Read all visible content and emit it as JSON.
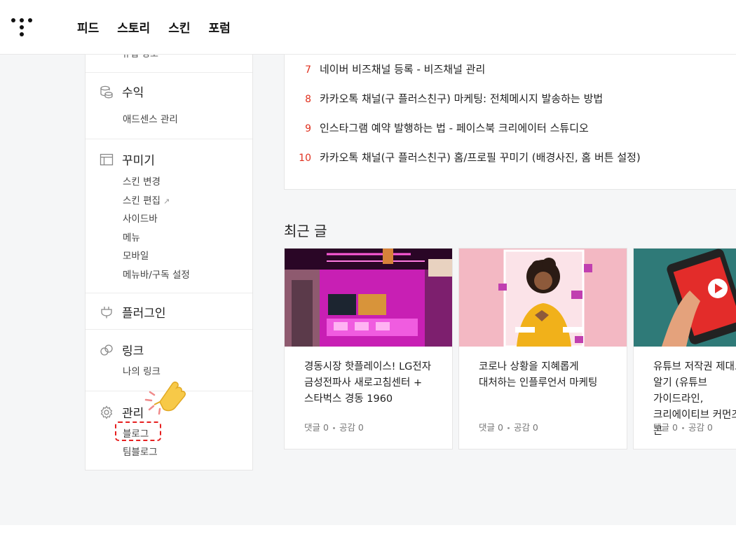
{
  "header": {
    "nav": [
      "피드",
      "스토리",
      "스킨",
      "포럼"
    ]
  },
  "sidebar": {
    "cut_top_label": "유입 경로",
    "sections": [
      {
        "title": "수익",
        "icon": "coins-icon",
        "items": [
          "애드센스 관리"
        ]
      },
      {
        "title": "꾸미기",
        "icon": "layout-icon",
        "items": [
          "스킨 변경",
          "스킨 편집",
          "사이드바",
          "메뉴",
          "모바일",
          "메뉴바/구독 설정"
        ]
      },
      {
        "title": "플러그인",
        "icon": "plug-icon",
        "items": []
      },
      {
        "title": "링크",
        "icon": "link-icon",
        "items": [
          "나의 링크"
        ]
      },
      {
        "title": "관리",
        "icon": "gear-icon",
        "items": [
          "블로그",
          "팀블로그"
        ]
      }
    ],
    "external_icon": "external-link-icon",
    "highlight_color": "#e62020",
    "pointer_color": "#f7c948"
  },
  "popular": {
    "rank_color": "#e0311f",
    "rows": [
      {
        "rank": "7",
        "title": "네이버 비즈채널 등록 - 비즈채널 관리"
      },
      {
        "rank": "8",
        "title": "카카오톡 채널(구 플러스친구) 마케팅: 전체메시지 발송하는 방법"
      },
      {
        "rank": "9",
        "title": "인스타그램 예약 발행하는 법 - 페이스북 크리에이터 스튜디오"
      },
      {
        "rank": "10",
        "title": "카카오톡 채널(구 플러스친구) 홈/프로필 꾸미기 (배경사진, 홈 버튼 설정)"
      }
    ]
  },
  "recent": {
    "heading": "최근 글",
    "posts": [
      {
        "title": "경동시장 핫플레이스! LG전자 금성전파사 새로고침센터 + 스타벅스 경동 1960",
        "comments": "댓글 0",
        "likes": "공감 0"
      },
      {
        "title": "코로나 상황을 지혜롭게 대처하는 인플루언서 마케팅",
        "comments": "댓글 0",
        "likes": "공감 0"
      },
      {
        "title": "유튜브 저작권 제대로 알기 (유튜브 가이드라인, 크리에이티브 커먼즈,콘",
        "comments": "댓글 0",
        "likes": "공감 0"
      }
    ]
  }
}
